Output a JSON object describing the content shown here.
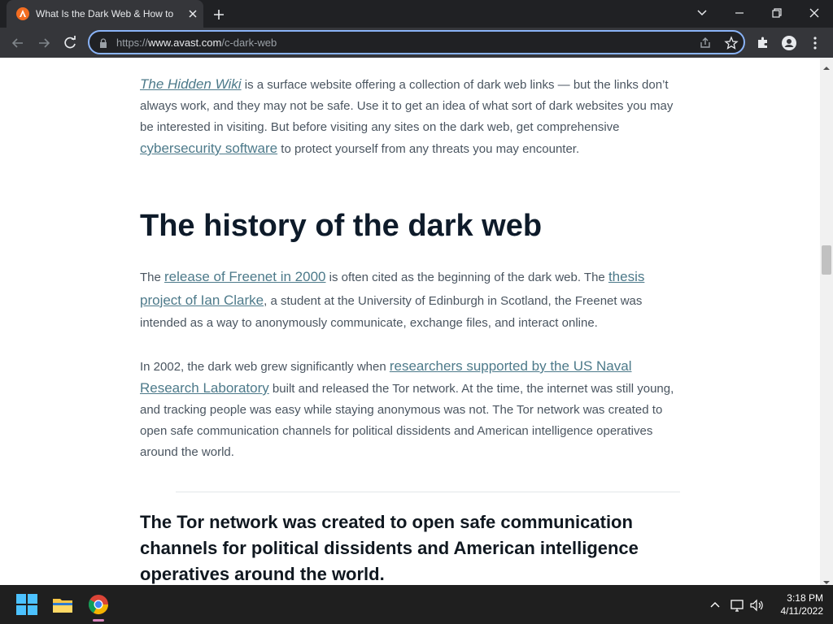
{
  "browser": {
    "tab_title": "What Is the Dark Web & How to",
    "url_scheme": "https://",
    "url_host": "www.avast.com",
    "url_path": "/c-dark-web"
  },
  "article": {
    "p1_link": "The Hidden Wiki",
    "p1_text_a": " is a surface website offering a collection of dark web links — but the links don’t always work, and they may not be safe. Use it to get an idea of what sort of dark websites you may be interested in visiting. But before visiting any sites on the dark web, get comprehensive ",
    "p1_link2": "cybersecurity software",
    "p1_text_b": " to protect yourself from any threats you may encounter.",
    "heading": "The history of the dark web",
    "p2_text_a": "The ",
    "p2_link1": "release of Freenet in 2000",
    "p2_text_b": " is often cited as the beginning of the dark web. The ",
    "p2_link2": "thesis project of Ian Clarke",
    "p2_text_c": ", a student at the University of Edinburgh in Scotland, the Freenet was intended as a way to anonymously communicate, exchange files, and interact online.",
    "p3_text_a": "In 2002, the dark web grew significantly when ",
    "p3_link": "researchers supported by the US Naval Research Laboratory",
    "p3_text_b": " built and released the Tor network. At the time, the internet was still young, and tracking people was easy while staying anonymous was not. The Tor network was created to open safe communication channels for political dissidents and American intelligence operatives around the world.",
    "pull_quote": "The Tor network was created to open safe communication channels for political dissidents and American intelligence operatives around the world."
  },
  "taskbar": {
    "time": "3:18 PM",
    "date": "4/11/2022"
  },
  "colors": {
    "accent_focus": "#8ab4f8",
    "link": "#4d7a8a",
    "heading": "#0e1b2a"
  }
}
